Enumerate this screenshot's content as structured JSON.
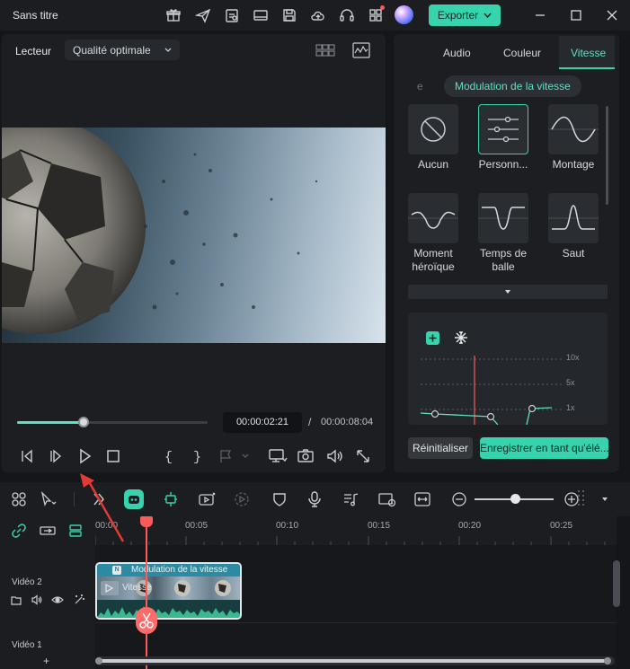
{
  "titlebar": {
    "title": "Sans titre",
    "export_label": "Exporter",
    "icons": [
      "gift-icon",
      "send-icon",
      "clipboard-icon",
      "monitor-icon",
      "save-icon",
      "cloud-upload-icon",
      "headset-icon",
      "grid-icon",
      "avatar-icon"
    ],
    "window_controls": [
      "minimize-icon",
      "maximize-icon",
      "close-icon"
    ]
  },
  "player": {
    "label": "Lecteur",
    "quality": "Qualité optimale",
    "progress_fraction": 0.35,
    "time_current": "00:00:02:21",
    "time_separator": "/",
    "time_total": "00:00:08:04"
  },
  "right_panel": {
    "tabs": [
      "Audio",
      "Couleur",
      "Vitesse"
    ],
    "active_tab": "Vitesse",
    "subtab_partial": "e",
    "subtab_active": "Modulation de la vitesse",
    "presets": [
      {
        "label": "Aucun"
      },
      {
        "label": "Personn..."
      },
      {
        "label": "Montage"
      },
      {
        "label": "Moment héroïque"
      },
      {
        "label": "Temps de balle"
      },
      {
        "label": "Saut"
      }
    ],
    "curve": {
      "speed_labels": [
        "10x",
        "5x",
        "1x"
      ]
    },
    "reset_label": "Réinitialiser",
    "save_as_label": "Enregistrer en tant qu'élé..."
  },
  "timeline": {
    "ruler_ticks": [
      "00:00",
      "00:05",
      "00:10",
      "00:15",
      "00:20",
      "00:25"
    ],
    "tracks": [
      {
        "name": "Vidéo 2"
      },
      {
        "name": "Vidéo 1"
      }
    ],
    "clip": {
      "title": "Modulation de la vitesse",
      "badge": "N",
      "speed_text": "Vitesse"
    },
    "add_track": "+"
  }
}
